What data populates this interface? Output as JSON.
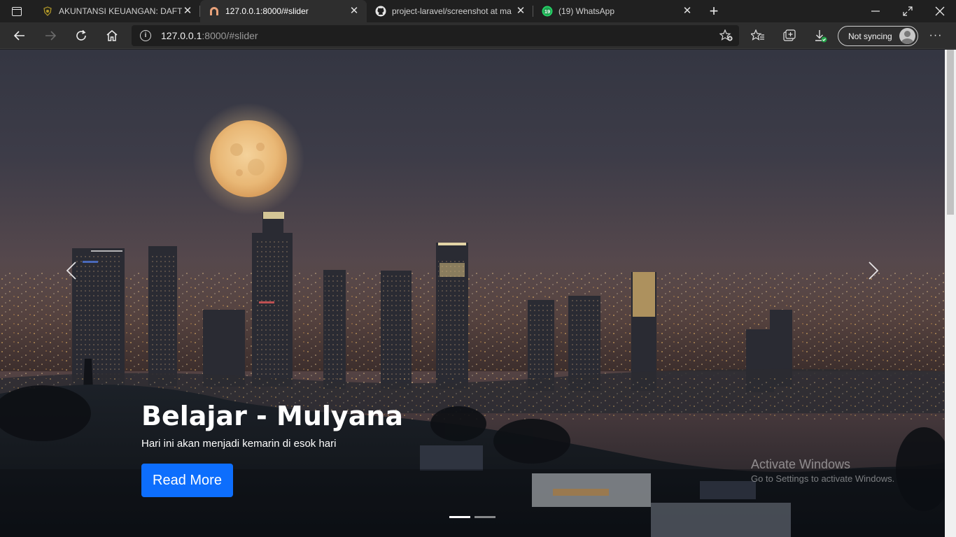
{
  "browser": {
    "tabs": [
      {
        "title": "AKUNTANSI KEUANGAN: DAFTAR",
        "active": false,
        "icon": "shield-emblem-icon"
      },
      {
        "title": "127.0.0.1:8000/#slider",
        "active": true,
        "icon": "arch-icon"
      },
      {
        "title": "project-laravel/screenshot at ma",
        "active": false,
        "icon": "github-icon"
      },
      {
        "title": "(19) WhatsApp",
        "active": false,
        "icon": "whatsapp-icon",
        "badge": "19"
      }
    ],
    "close_glyph": "✕",
    "new_tab_glyph": "+",
    "address": {
      "host": "127.0.0.1",
      "path": ":8000/#slider"
    },
    "sync_label": "Not syncing",
    "more_glyph": "···",
    "window": {
      "minimize": "—",
      "restore": "⤡",
      "close": "✕"
    }
  },
  "slider": {
    "title": "Belajar - Mulyana",
    "subtitle": "Hari ini akan menjadi kemarin di esok hari",
    "button_label": "Read More",
    "slide_count": 2,
    "active_slide": 1
  },
  "watermark": {
    "line1": "Activate Windows",
    "line2": "Go to Settings to activate Windows."
  },
  "colors": {
    "button": "#0d6efd",
    "tab_bar": "#202020",
    "toolbar": "#2e2e2e",
    "sky_top": "#3a3c4a",
    "sky_horizon": "#6a4e4a"
  }
}
